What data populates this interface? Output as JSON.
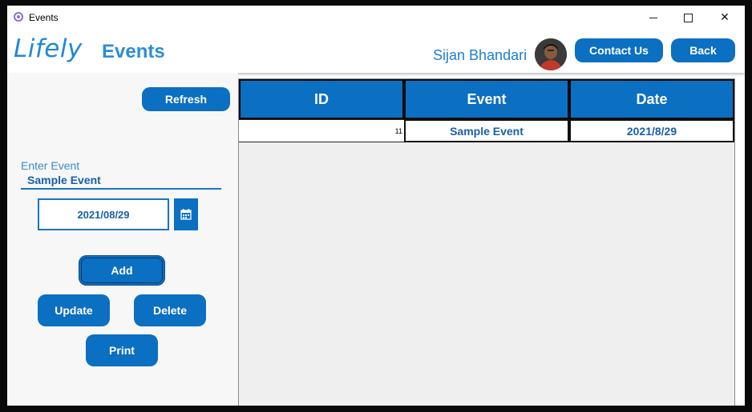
{
  "window": {
    "title": "Events"
  },
  "header": {
    "logo": "Lifely",
    "page_title": "Events",
    "user_name": "Sijan Bhandari",
    "contact_label": "Contact Us",
    "back_label": "Back"
  },
  "form": {
    "refresh_label": "Refresh",
    "event_label": "Enter Event",
    "event_value": "Sample Event",
    "date_value": "2021/08/29",
    "add_label": "Add",
    "update_label": "Update",
    "delete_label": "Delete",
    "print_label": "Print"
  },
  "table": {
    "columns": [
      "ID",
      "Event",
      "Date"
    ],
    "rows": [
      {
        "id": "11",
        "event": "Sample Event",
        "date": "2021/8/29"
      }
    ]
  },
  "colors": {
    "primary": "#0b6fc2",
    "accent_text": "#1a5fa8"
  },
  "icons": {
    "app": "app-icon",
    "calendar": "calendar-icon",
    "avatar": "user-avatar"
  }
}
